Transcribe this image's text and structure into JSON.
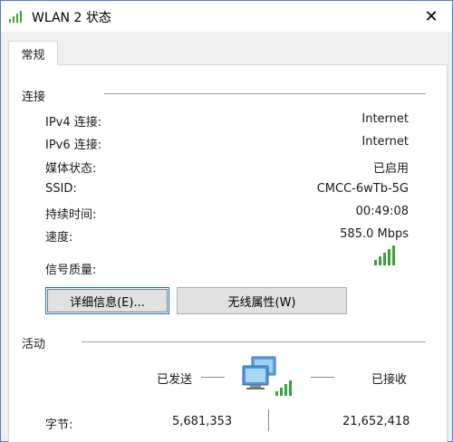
{
  "window": {
    "title": "WLAN 2 状态",
    "close_glyph": "✕"
  },
  "tabs": [
    {
      "label": "常规"
    }
  ],
  "connection": {
    "heading": "连接",
    "rows": [
      {
        "label": "IPv4 连接:",
        "value": "Internet"
      },
      {
        "label": "IPv6 连接:",
        "value": "Internet"
      },
      {
        "label": "媒体状态:",
        "value": "已启用"
      },
      {
        "label": "SSID:",
        "value": "CMCC-6wTb-5G"
      },
      {
        "label": "持续时间:",
        "value": "00:49:08"
      },
      {
        "label": "速度:",
        "value": "585.0 Mbps"
      }
    ],
    "signal_label": "信号质量:",
    "signal_bars_lit": 5,
    "signal_bars_total": 5,
    "signal_color": "#3aa23a"
  },
  "buttons": {
    "details": "详细信息(E)...",
    "wireless_props": "无线属性(W)"
  },
  "activity": {
    "heading": "活动",
    "sent_label": "已发送",
    "received_label": "已接收",
    "bytes_label": "字节:",
    "bytes_sent": "5,681,353",
    "bytes_received": "21,652,418",
    "network_icon": "network-computers-icon"
  }
}
